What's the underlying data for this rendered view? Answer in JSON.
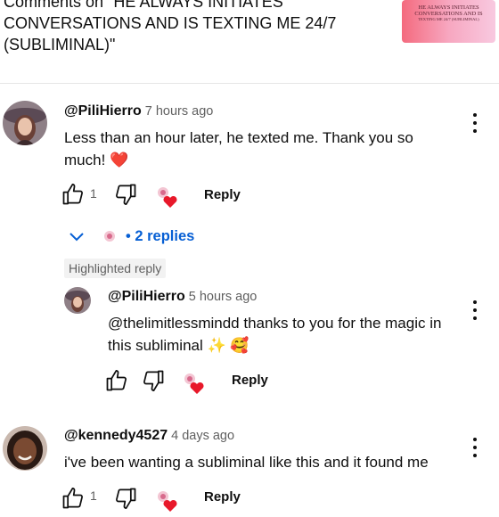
{
  "header": {
    "lines": [
      "Comments on \"HE ALWAYS INITIATES",
      "CONVERSATIONS AND IS TEXTING ME 24/7",
      "(SUBLIMINAL)\""
    ],
    "thumbnail_lines": [
      "HE ALWAYS INITIATES",
      "CONVERSATIONS AND IS",
      "TEXTING ME 24/7 (SUBLIMINAL)"
    ]
  },
  "comments": [
    {
      "handle": "@PiliHierro",
      "time": "7 hours ago",
      "text_lines": [
        "Less than an hour later, he texted me. Thank you so",
        "much! ❤️"
      ],
      "likes": "1",
      "reply_label": "Reply",
      "replies_label": "2 replies"
    },
    {
      "badge": "Highlighted reply",
      "handle": "@PiliHierro",
      "time": "5 hours ago",
      "text_lines": [
        "@thelimitlessmindd thanks to you for the magic in",
        "this subliminal ✨ 🥰"
      ],
      "reply_label": "Reply"
    },
    {
      "handle": "@kennedy4527",
      "time": "4 days ago",
      "text_lines": [
        "i've been wanting a subliminal like this and it found me"
      ],
      "likes": "1",
      "reply_label": "Reply"
    }
  ],
  "colors": {
    "link": "#065fd4",
    "secondary": "#606060",
    "heart": "#e8182a"
  }
}
